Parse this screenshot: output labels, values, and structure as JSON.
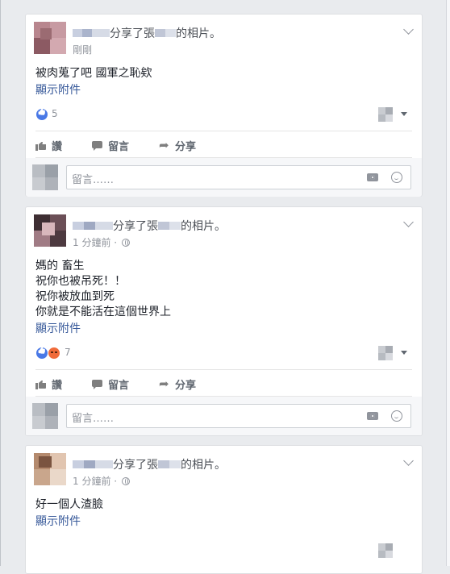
{
  "feed": {
    "posts": [
      {
        "header_prefix": "分享了張",
        "header_suffix": "的相片。",
        "time": "剛剛",
        "body_lines": [
          "被肉蒐了吧 國軍之恥欸"
        ],
        "attachment_link": "顯示附件",
        "reaction_count": "5",
        "reactions": [
          "like"
        ]
      },
      {
        "header_prefix": "分享了張",
        "header_suffix": "的相片。",
        "time": "1 分鐘前 ·",
        "body_lines": [
          "媽的 畜生",
          "祝你也被吊死！！",
          "祝你被放血到死",
          "你就是不能活在這個世界上"
        ],
        "attachment_link": "顯示附件",
        "reaction_count": "7",
        "reactions": [
          "like",
          "angry"
        ]
      },
      {
        "header_prefix": "分享了張",
        "header_suffix": "的相片。",
        "time": "1 分鐘前 ·",
        "body_lines": [
          "好一個人渣臉"
        ],
        "attachment_link": "顯示附件"
      }
    ]
  },
  "actions": {
    "like_label": "讚",
    "comment_label": "留言",
    "share_label": "分享"
  },
  "composer": {
    "placeholder": "留言……"
  },
  "icons": {
    "like": "thumbs-up-icon",
    "angry": "angry-face-icon",
    "comment": "comment-bubble-icon",
    "share": "share-arrow-icon",
    "camera": "camera-icon",
    "emoji": "smiley-icon",
    "privacy": "globe-icon"
  },
  "colors": {
    "background": "#e9ebee",
    "link": "#365899",
    "like_blue": "#4a79e6",
    "angry_orange": "#f06b3a"
  }
}
